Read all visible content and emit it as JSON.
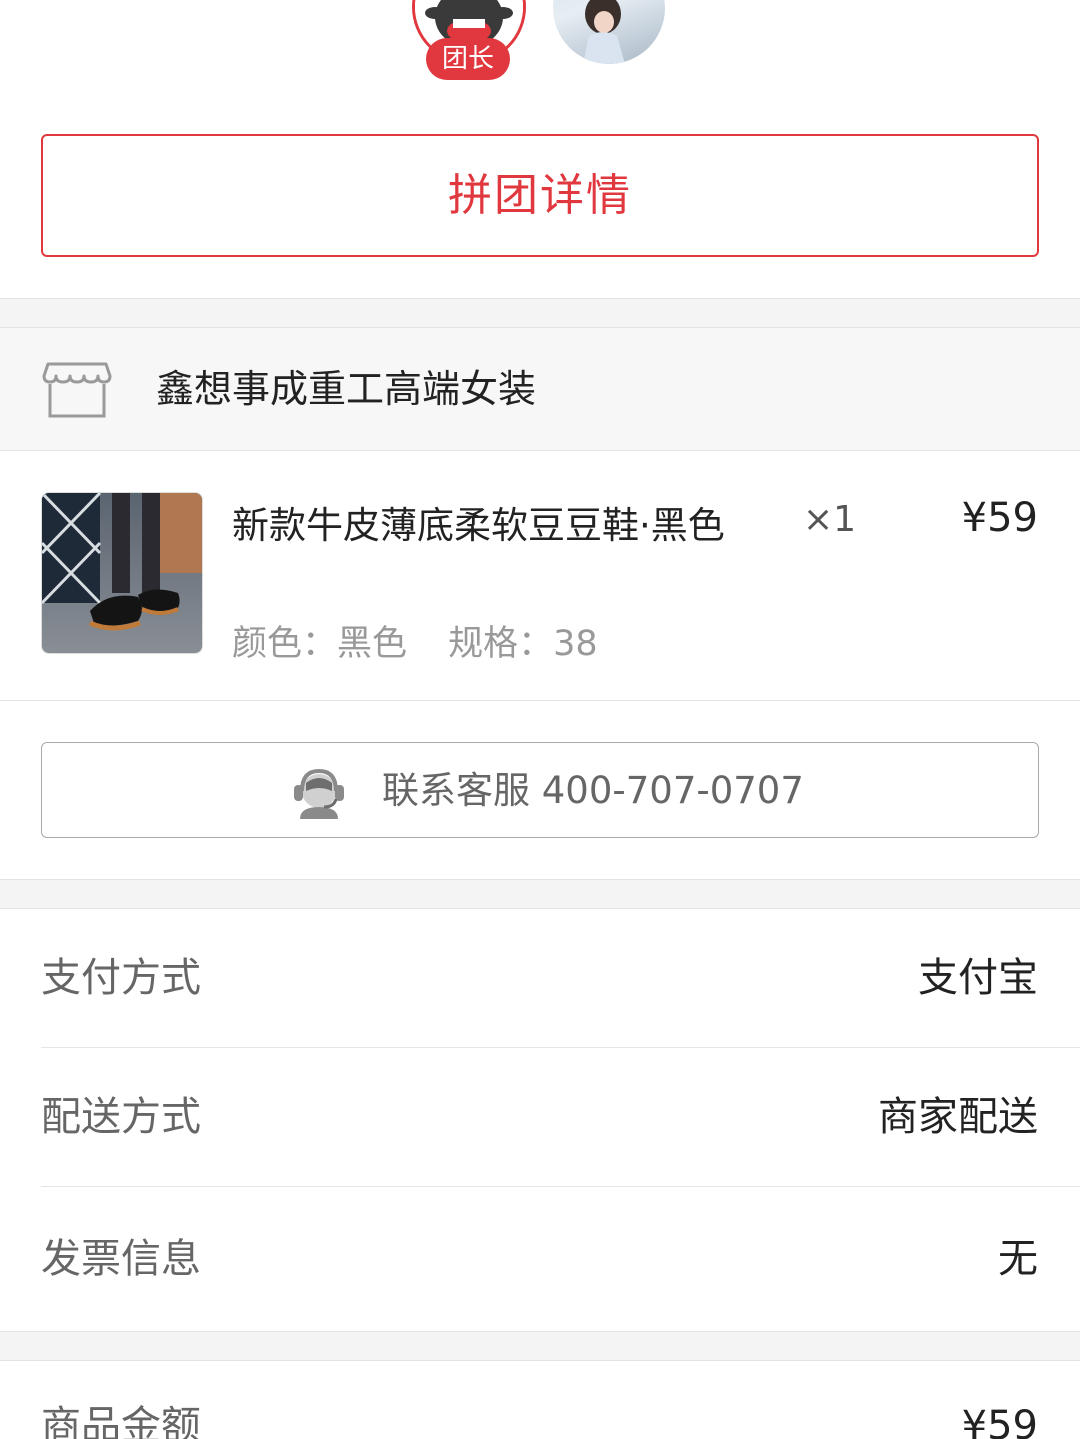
{
  "group": {
    "leader_badge": "团长",
    "detail_button": "拼团详情"
  },
  "shop": {
    "icon": "store-icon",
    "name": "鑫想事成重工高端女装"
  },
  "product": {
    "title": "新款牛皮薄底柔软豆豆鞋·黑色",
    "quantity": "×1",
    "price": "¥59",
    "color": "颜色：黑色",
    "size": "规格：38"
  },
  "service": {
    "icon": "headset-support-icon",
    "label": "联系客服 400-707-0707"
  },
  "info": [
    {
      "label": "支付方式",
      "value": "支付宝"
    },
    {
      "label": "配送方式",
      "value": "商家配送"
    },
    {
      "label": "发票信息",
      "value": "无"
    }
  ],
  "summary": {
    "label": "商品金额",
    "value": "¥59"
  },
  "colors": {
    "accent": "#e0383e",
    "background_gray": "#f4f4f4"
  }
}
